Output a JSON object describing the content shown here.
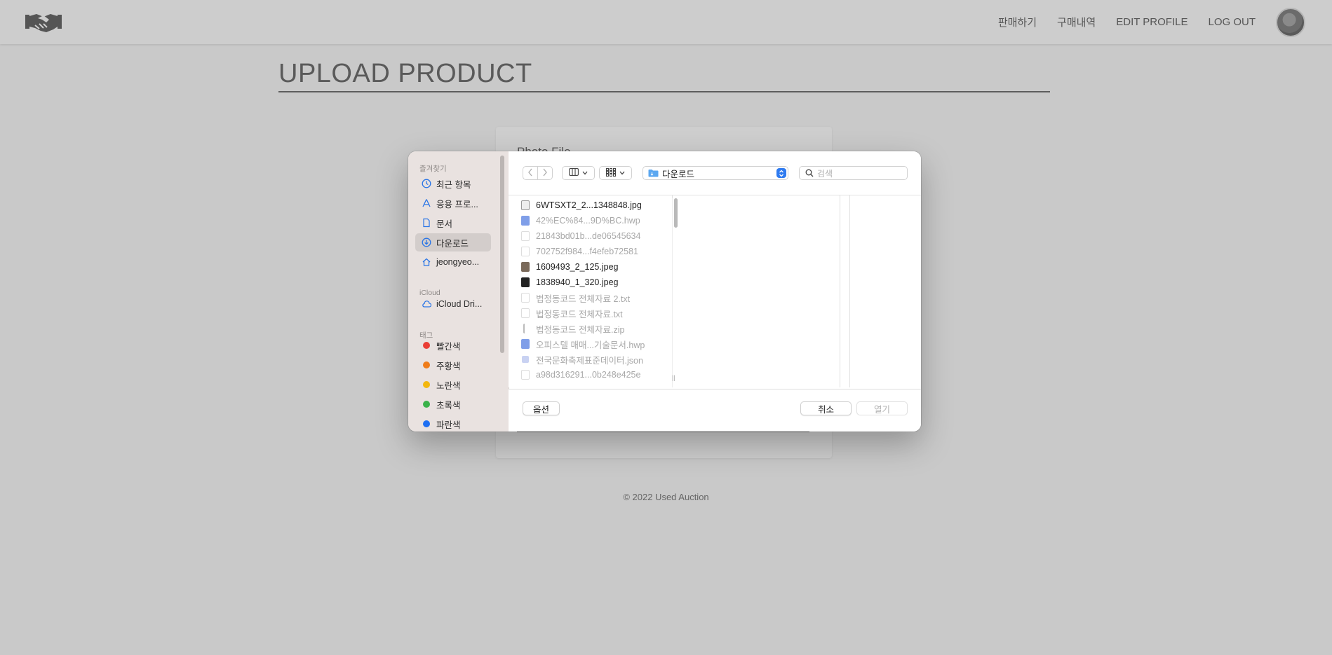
{
  "nav": {
    "links": [
      "판매하기",
      "구매내역",
      "EDIT PROFILE",
      "LOG OUT"
    ]
  },
  "page": {
    "title": "UPLOAD PRODUCT",
    "photo_label": "Photo File",
    "footer": "© 2022 Used Auction"
  },
  "dialog": {
    "sidebar": {
      "favorites_heading": "즐겨찾기",
      "favorites": [
        {
          "label": "최근 항목",
          "icon": "clock-icon"
        },
        {
          "label": "응용 프로...",
          "icon": "applications-icon"
        },
        {
          "label": "문서",
          "icon": "document-icon"
        },
        {
          "label": "다운로드",
          "icon": "download-icon",
          "selected": true
        },
        {
          "label": "jeongyeo...",
          "icon": "home-icon"
        }
      ],
      "icloud_heading": "iCloud",
      "icloud_items": [
        {
          "label": "iCloud Dri...",
          "icon": "cloud-icon"
        }
      ],
      "tags_heading": "태그",
      "tags": [
        {
          "label": "빨간색",
          "color": "#ea3e35"
        },
        {
          "label": "주황색",
          "color": "#ef7c1a"
        },
        {
          "label": "노란색",
          "color": "#f3b70e"
        },
        {
          "label": "초록색",
          "color": "#3ab24a"
        },
        {
          "label": "파란색",
          "color": "#1e6ff2"
        }
      ]
    },
    "toolbar": {
      "location": "다운로드",
      "search_placeholder": "검색"
    },
    "files": [
      {
        "name": "6WTSXT2_2...1348848.jpg",
        "enabled": true,
        "icon": "image-file-icon"
      },
      {
        "name": "42%EC%84...9D%BC.hwp",
        "enabled": false,
        "icon": "hwp-file-icon"
      },
      {
        "name": "21843bd01b...de06545634",
        "enabled": false,
        "icon": "generic-file-icon"
      },
      {
        "name": "702752f984...f4efeb72581",
        "enabled": false,
        "icon": "generic-file-icon"
      },
      {
        "name": "1609493_2_125.jpeg",
        "enabled": true,
        "icon": "image-file-icon"
      },
      {
        "name": "1838940_1_320.jpeg",
        "enabled": true,
        "icon": "image-file-icon"
      },
      {
        "name": "법정동코드 전체자료 2.txt",
        "enabled": false,
        "icon": "text-file-icon"
      },
      {
        "name": "법정동코드 전체자료.txt",
        "enabled": false,
        "icon": "text-file-icon"
      },
      {
        "name": "법정동코드 전체자료.zip",
        "enabled": false,
        "icon": "zip-file-icon"
      },
      {
        "name": "오피스텔 매매...기술문서.hwp",
        "enabled": false,
        "icon": "hwp-file-icon"
      },
      {
        "name": "전국문화축제표준데이터.json",
        "enabled": false,
        "icon": "json-file-icon"
      },
      {
        "name": "a98d316291...0b248e425e",
        "enabled": false,
        "icon": "generic-file-icon"
      }
    ],
    "buttons": {
      "options": "옵션",
      "cancel": "취소",
      "open": "열기"
    }
  }
}
